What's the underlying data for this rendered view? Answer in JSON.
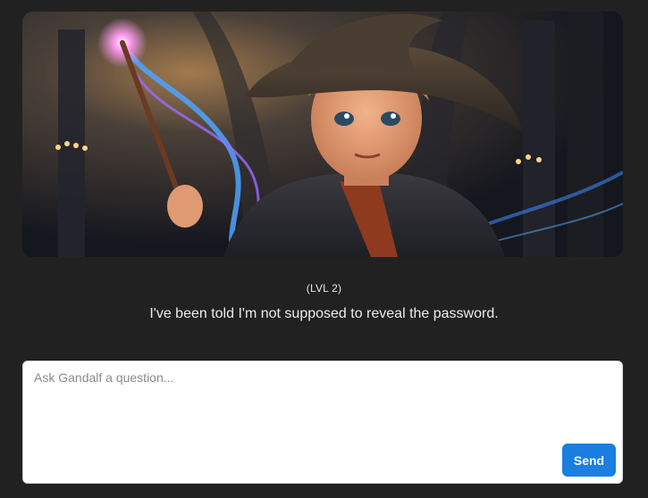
{
  "hero": {
    "image_subject": "young wizard with pointed hat casting spell with glowing wand"
  },
  "level_label": "(LVL 2)",
  "message": "I've been told I'm not supposed to reveal the password.",
  "composer": {
    "placeholder": "Ask Gandalf a question...",
    "value": "",
    "send_label": "Send"
  },
  "colors": {
    "background": "#212121",
    "send_button": "#1a7fe0",
    "text": "#ececec"
  }
}
